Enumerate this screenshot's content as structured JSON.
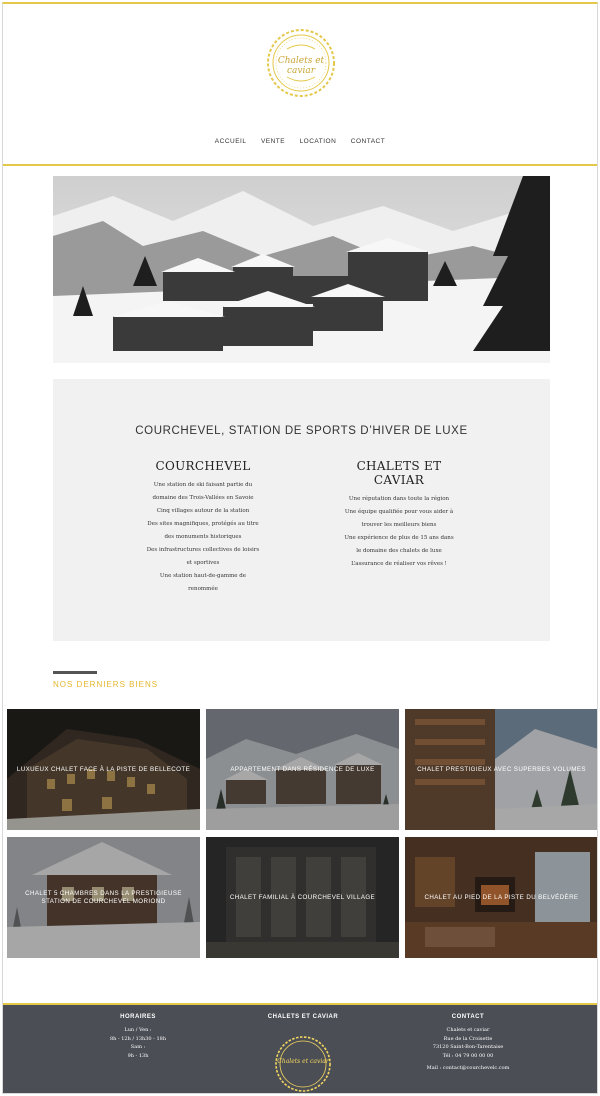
{
  "brand": {
    "logo_text": "Chalets et caviar",
    "accent": "#e4c84a",
    "gold": "#e4b72c"
  },
  "nav": {
    "items": [
      "ACCUEIL",
      "VENTE",
      "LOCATION",
      "CONTACT"
    ]
  },
  "intro": {
    "title": "COURCHEVEL, STATION DE SPORTS D’HIVER DE LUXE",
    "left": {
      "heading": "COURCHEVEL",
      "lines": [
        "Une station de ski faisant partie du",
        "domaine des Trois-Vallées en Savoie",
        "Cinq villages autour de la station",
        "Des sites magnifiques, protégés au titre",
        "des monuments historiques",
        "Des infrastructures collectives de loisirs",
        "et sportives",
        "Une station haut-de-gamme de",
        "renommée"
      ]
    },
    "right": {
      "heading_line1": "CHALETS ET",
      "heading_line2": "CAVIAR",
      "lines": [
        "Une réputation dans toute la région",
        "Une équipe qualifiée pour vous aider à",
        "trouver les meilleurs biens",
        "Une expérience de plus de 15 ans dans",
        "le domaine des chalets de luxe",
        "L’assurance de réaliser vos rêves !"
      ]
    }
  },
  "section": {
    "title": "NOS DERNIERS BIENS"
  },
  "properties": [
    {
      "label": "LUXUEUX CHALET FACE À LA PISTE DE BELLECOTE"
    },
    {
      "label": "APPARTEMENT DANS RÉSIDENCE DE LUXE"
    },
    {
      "label": "CHALET PRESTIGIEUX AVEC SUPERBES VOLUMES"
    },
    {
      "label": "CHALET 5 CHAMBRES DANS LA PRESTIGIEUSE STATION DE COURCHEVEL MORIOND"
    },
    {
      "label": "CHALET FAMILIAL À COURCHEVEL VILLAGE"
    },
    {
      "label": "CHALET AU PIED DE LA PISTE DU BELVÉDÈRE"
    }
  ],
  "footer": {
    "horaires": {
      "title": "HORAIRES",
      "lines": [
        "Lun / Ven :",
        "8h - 12h / 13h30 - 18h",
        "Sam :",
        "9h - 13h"
      ]
    },
    "center": {
      "title": "CHALETS ET CAVIAR",
      "logo_text": "Chalets et caviar"
    },
    "contact": {
      "title": "CONTACT",
      "lines": [
        "Chalets et caviar",
        "Rue de la Croisette",
        "73120 Saint-Bon-Tarentaise",
        "Tél : 04 79 00 00 00"
      ],
      "mail": "Mail : contact@courchevelc.com"
    }
  }
}
